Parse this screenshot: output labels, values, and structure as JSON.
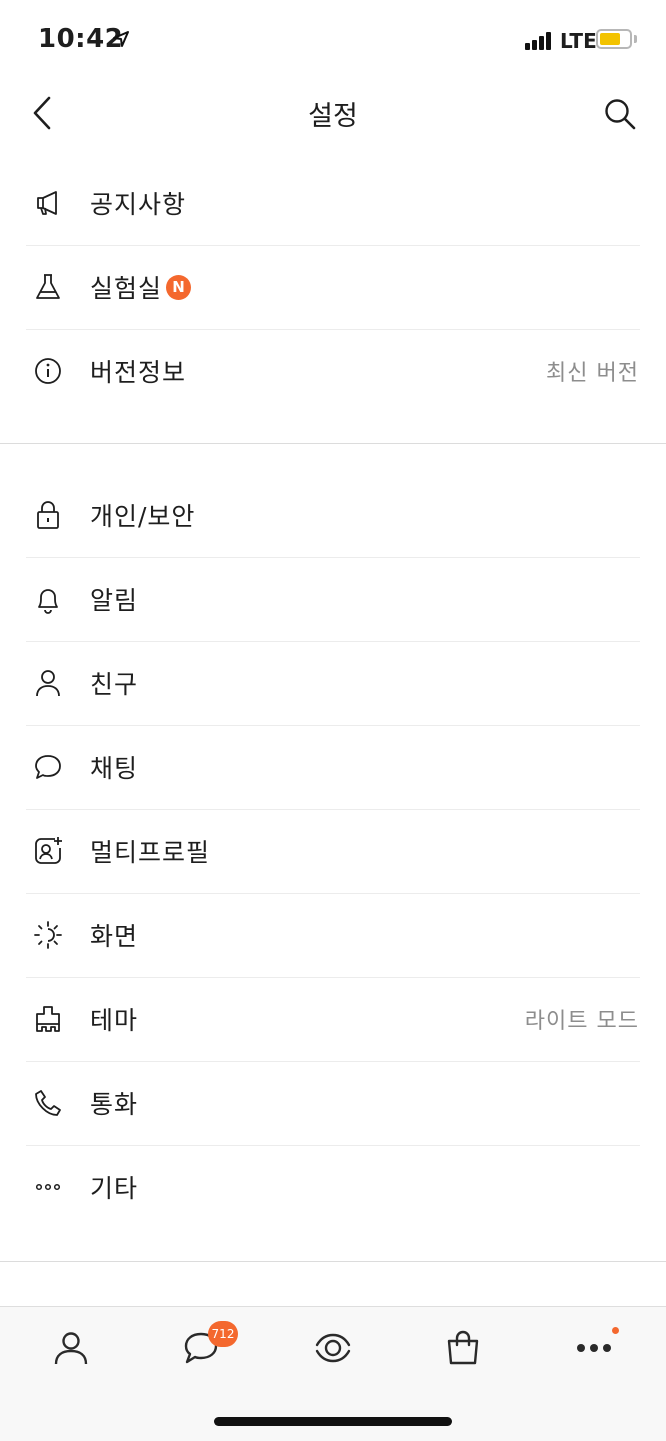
{
  "status_bar": {
    "time": "10:42",
    "network": "LTE",
    "battery_level": 0.7,
    "battery_color": "#f3c300"
  },
  "header": {
    "title": "설정",
    "back_icon": "chevron-left-icon",
    "search_icon": "search-icon"
  },
  "sections": [
    {
      "items": [
        {
          "label": "공지사항",
          "icon": "megaphone-icon"
        },
        {
          "label": "실험실",
          "icon": "flask-icon",
          "badge": "N"
        },
        {
          "label": "버전정보",
          "icon": "info-icon",
          "value": "최신 버전"
        }
      ]
    },
    {
      "items": [
        {
          "label": "개인/보안",
          "icon": "lock-icon"
        },
        {
          "label": "알림",
          "icon": "bell-icon"
        },
        {
          "label": "친구",
          "icon": "person-icon"
        },
        {
          "label": "채팅",
          "icon": "chat-bubble-icon"
        },
        {
          "label": "멀티프로필",
          "icon": "profile-add-icon"
        },
        {
          "label": "화면",
          "icon": "brightness-icon"
        },
        {
          "label": "테마",
          "icon": "paint-brush-icon",
          "value": "라이트 모드"
        },
        {
          "label": "통화",
          "icon": "phone-icon"
        },
        {
          "label": "기타",
          "icon": "more-dots-icon"
        }
      ]
    }
  ],
  "tab_bar": {
    "tabs": [
      {
        "icon": "friends-tab-icon"
      },
      {
        "icon": "chats-tab-icon",
        "badge": "712"
      },
      {
        "icon": "view-tab-icon"
      },
      {
        "icon": "shopping-tab-icon"
      },
      {
        "icon": "more-tab-icon",
        "has_dot": true
      }
    ]
  },
  "colors": {
    "accent": "#f4682e",
    "text": "#1e1e1e",
    "secondary_text": "#8d8d8d",
    "divider": "#ececec",
    "tab_bar_bg": "#f8f8f8"
  }
}
